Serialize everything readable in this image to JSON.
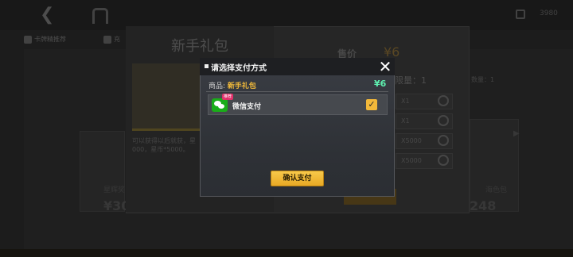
{
  "topbar": {
    "currency_value": "3980",
    "subnav": [
      {
        "label": "卡牌精推荐"
      },
      {
        "label": "充"
      }
    ]
  },
  "background_shop": {
    "prices": [
      "¥30",
      "248"
    ],
    "card_label_left": "星辉奖",
    "card_label_right": "海色包"
  },
  "detail": {
    "title": "新手礼包",
    "description": "可以获得以后就获，星\n000，星币*5000。",
    "price_label": "售价",
    "price_value": "¥6",
    "limit_label": "限量：1",
    "limit_label_right": "数量：1",
    "rows": [
      "X1",
      "X1",
      "X5000",
      "X5000"
    ]
  },
  "modal": {
    "title": "请选择支付方式",
    "product_prefix": "商品:",
    "product_name": "新手礼包",
    "product_price": "¥6",
    "payment_method": "微信支付",
    "recommend_badge": "推荐",
    "confirm_label": "确认支付",
    "checkbox_checked": true
  },
  "colors": {
    "accent": "#f2b83a",
    "price_green": "#5ef0b0",
    "wechat_green": "#1aad19"
  }
}
